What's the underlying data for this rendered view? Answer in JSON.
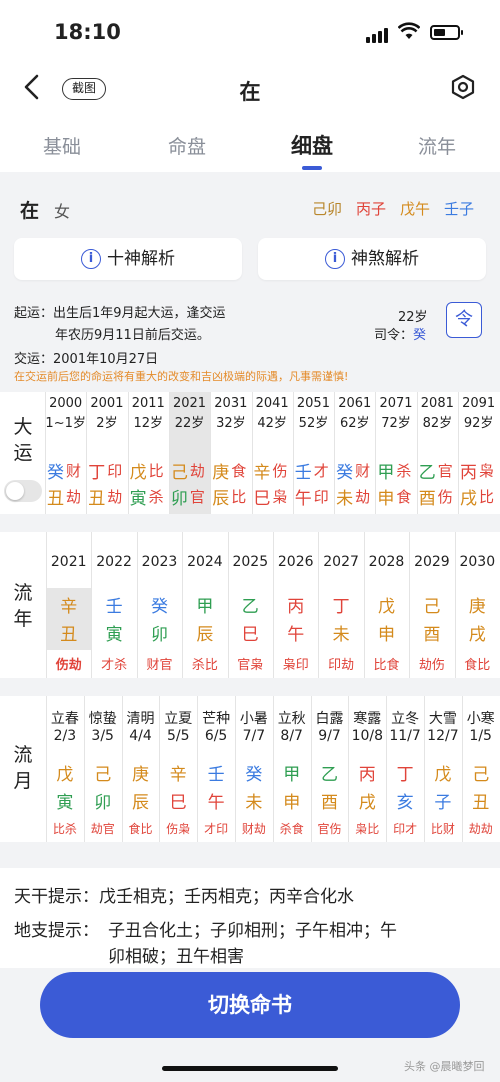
{
  "status": {
    "time": "18:10"
  },
  "nav": {
    "screenshot_label": "截图",
    "title": "在"
  },
  "tabs": [
    "基础",
    "命盘",
    "细盘",
    "流年"
  ],
  "person": {
    "name": "在",
    "gender": "女",
    "pillars": [
      {
        "text": "己卯",
        "color": "#b8862b"
      },
      {
        "text": "丙子",
        "color": "#e0443a"
      },
      {
        "text": "戊午",
        "color": "#d48a1c"
      },
      {
        "text": "壬子",
        "color": "#3b7be0"
      }
    ]
  },
  "buttons": {
    "shishen": "十神解析",
    "shensha": "神煞解析"
  },
  "qiyun": {
    "line1": "起运：出生后1年9月起大运，逢交运",
    "line2": "年农历9月11日前后交运。",
    "age": "22岁",
    "siling_label": "司令：",
    "siling_value": "癸",
    "siling_icon": "令",
    "jiaoyun": "交运：2001年10月27日",
    "warning": "在交运前后您的命运将有重大的改变和吉凶极端的际遇，凡事需谨慎!"
  },
  "dayun": {
    "label": "大运",
    "columns": [
      {
        "year": "2000",
        "age": "1~1岁",
        "gan": "癸",
        "zhi": "丑",
        "gan_color": "#3b7be0",
        "zhi_color": "#d48a1c",
        "s1": "财",
        "s2": "劫",
        "s1c": "#e0443a",
        "s2c": "#e0443a"
      },
      {
        "year": "2001",
        "age": "2岁",
        "gan": "丁",
        "zhi": "丑",
        "gan_color": "#e0443a",
        "zhi_color": "#d48a1c",
        "s1": "印",
        "s2": "劫",
        "s1c": "#e0443a",
        "s2c": "#e0443a"
      },
      {
        "year": "2011",
        "age": "12岁",
        "gan": "戊",
        "zhi": "寅",
        "gan_color": "#d48a1c",
        "zhi_color": "#2f9e52",
        "s1": "比",
        "s2": "杀",
        "s1c": "#e0443a",
        "s2c": "#e0443a"
      },
      {
        "year": "2021",
        "age": "22岁",
        "gan": "己",
        "zhi": "卯",
        "gan_color": "#d48a1c",
        "zhi_color": "#2f9e52",
        "s1": "劫",
        "s2": "官",
        "s1c": "#e0443a",
        "s2c": "#e0443a",
        "active": true
      },
      {
        "year": "2031",
        "age": "32岁",
        "gan": "庚",
        "zhi": "辰",
        "gan_color": "#d48a1c",
        "zhi_color": "#d48a1c",
        "s1": "食",
        "s2": "比",
        "s1c": "#e0443a",
        "s2c": "#e0443a"
      },
      {
        "year": "2041",
        "age": "42岁",
        "gan": "辛",
        "zhi": "巳",
        "gan_color": "#d48a1c",
        "zhi_color": "#e0443a",
        "s1": "伤",
        "s2": "枭",
        "s1c": "#e0443a",
        "s2c": "#e0443a"
      },
      {
        "year": "2051",
        "age": "52岁",
        "gan": "壬",
        "zhi": "午",
        "gan_color": "#3b7be0",
        "zhi_color": "#e0443a",
        "s1": "才",
        "s2": "印",
        "s1c": "#e0443a",
        "s2c": "#e0443a"
      },
      {
        "year": "2061",
        "age": "62岁",
        "gan": "癸",
        "zhi": "未",
        "gan_color": "#3b7be0",
        "zhi_color": "#d48a1c",
        "s1": "财",
        "s2": "劫",
        "s1c": "#e0443a",
        "s2c": "#e0443a"
      },
      {
        "year": "2071",
        "age": "72岁",
        "gan": "甲",
        "zhi": "申",
        "gan_color": "#2f9e52",
        "zhi_color": "#d48a1c",
        "s1": "杀",
        "s2": "食",
        "s1c": "#e0443a",
        "s2c": "#e0443a"
      },
      {
        "year": "2081",
        "age": "82岁",
        "gan": "乙",
        "zhi": "酉",
        "gan_color": "#2f9e52",
        "zhi_color": "#d48a1c",
        "s1": "官",
        "s2": "伤",
        "s1c": "#e0443a",
        "s2c": "#e0443a"
      },
      {
        "year": "2091",
        "age": "92岁",
        "gan": "丙",
        "zhi": "戌",
        "gan_color": "#e0443a",
        "zhi_color": "#d48a1c",
        "s1": "枭",
        "s2": "比",
        "s1c": "#e0443a",
        "s2c": "#e0443a"
      }
    ]
  },
  "liunian": {
    "label": "流年",
    "columns": [
      {
        "year": "2021",
        "gan": "辛",
        "zhi": "丑",
        "gan_color": "#d48a1c",
        "zhi_color": "#d48a1c",
        "ss": "伤劫",
        "active": true
      },
      {
        "year": "2022",
        "gan": "壬",
        "zhi": "寅",
        "gan_color": "#3b7be0",
        "zhi_color": "#2f9e52",
        "ss": "才杀"
      },
      {
        "year": "2023",
        "gan": "癸",
        "zhi": "卯",
        "gan_color": "#3b7be0",
        "zhi_color": "#2f9e52",
        "ss": "财官"
      },
      {
        "year": "2024",
        "gan": "甲",
        "zhi": "辰",
        "gan_color": "#2f9e52",
        "zhi_color": "#d48a1c",
        "ss": "杀比"
      },
      {
        "year": "2025",
        "gan": "乙",
        "zhi": "巳",
        "gan_color": "#2f9e52",
        "zhi_color": "#e0443a",
        "ss": "官枭"
      },
      {
        "year": "2026",
        "gan": "丙",
        "zhi": "午",
        "gan_color": "#e0443a",
        "zhi_color": "#e0443a",
        "ss": "枭印"
      },
      {
        "year": "2027",
        "gan": "丁",
        "zhi": "未",
        "gan_color": "#e0443a",
        "zhi_color": "#d48a1c",
        "ss": "印劫"
      },
      {
        "year": "2028",
        "gan": "戊",
        "zhi": "申",
        "gan_color": "#d48a1c",
        "zhi_color": "#d48a1c",
        "ss": "比食"
      },
      {
        "year": "2029",
        "gan": "己",
        "zhi": "酉",
        "gan_color": "#d48a1c",
        "zhi_color": "#d48a1c",
        "ss": "劫伤"
      },
      {
        "year": "2030",
        "gan": "庚",
        "zhi": "戌",
        "gan_color": "#d48a1c",
        "zhi_color": "#d48a1c",
        "ss": "食比"
      }
    ]
  },
  "liuyue": {
    "label": "流月",
    "columns": [
      {
        "term": "立春",
        "date": "2/3",
        "gan": "戊",
        "zhi": "寅",
        "gan_color": "#d48a1c",
        "zhi_color": "#2f9e52",
        "ss": "比杀"
      },
      {
        "term": "惊蛰",
        "date": "3/5",
        "gan": "己",
        "zhi": "卯",
        "gan_color": "#d48a1c",
        "zhi_color": "#2f9e52",
        "ss": "劫官"
      },
      {
        "term": "清明",
        "date": "4/4",
        "gan": "庚",
        "zhi": "辰",
        "gan_color": "#d48a1c",
        "zhi_color": "#d48a1c",
        "ss": "食比"
      },
      {
        "term": "立夏",
        "date": "5/5",
        "gan": "辛",
        "zhi": "巳",
        "gan_color": "#d48a1c",
        "zhi_color": "#e0443a",
        "ss": "伤枭"
      },
      {
        "term": "芒种",
        "date": "6/5",
        "gan": "壬",
        "zhi": "午",
        "gan_color": "#3b7be0",
        "zhi_color": "#e0443a",
        "ss": "才印"
      },
      {
        "term": "小暑",
        "date": "7/7",
        "gan": "癸",
        "zhi": "未",
        "gan_color": "#3b7be0",
        "zhi_color": "#d48a1c",
        "ss": "财劫"
      },
      {
        "term": "立秋",
        "date": "8/7",
        "gan": "甲",
        "zhi": "申",
        "gan_color": "#2f9e52",
        "zhi_color": "#d48a1c",
        "ss": "杀食"
      },
      {
        "term": "白露",
        "date": "9/7",
        "gan": "乙",
        "zhi": "酉",
        "gan_color": "#2f9e52",
        "zhi_color": "#d48a1c",
        "ss": "官伤"
      },
      {
        "term": "寒露",
        "date": "10/8",
        "gan": "丙",
        "zhi": "戌",
        "gan_color": "#e0443a",
        "zhi_color": "#d48a1c",
        "ss": "枭比"
      },
      {
        "term": "立冬",
        "date": "11/7",
        "gan": "丁",
        "zhi": "亥",
        "gan_color": "#e0443a",
        "zhi_color": "#3b7be0",
        "ss": "印才"
      },
      {
        "term": "大雪",
        "date": "12/7",
        "gan": "戊",
        "zhi": "子",
        "gan_color": "#d48a1c",
        "zhi_color": "#3b7be0",
        "ss": "比财"
      },
      {
        "term": "小寒",
        "date": "1/5",
        "gan": "己",
        "zhi": "丑",
        "gan_color": "#d48a1c",
        "zhi_color": "#d48a1c",
        "ss": "劫劫"
      }
    ]
  },
  "tips": {
    "tiangan_label": "天干提示：",
    "tiangan": "戊壬相克；壬丙相克；丙辛合化水",
    "dizhi_label": "地支提示：",
    "dizhi_1": "子丑合化土；子卯相刑；子午相冲；午",
    "dizhi_2": "卯相破；丑午相害"
  },
  "switch_label": "切换命书",
  "watermark": "头条 @晨曦梦回"
}
